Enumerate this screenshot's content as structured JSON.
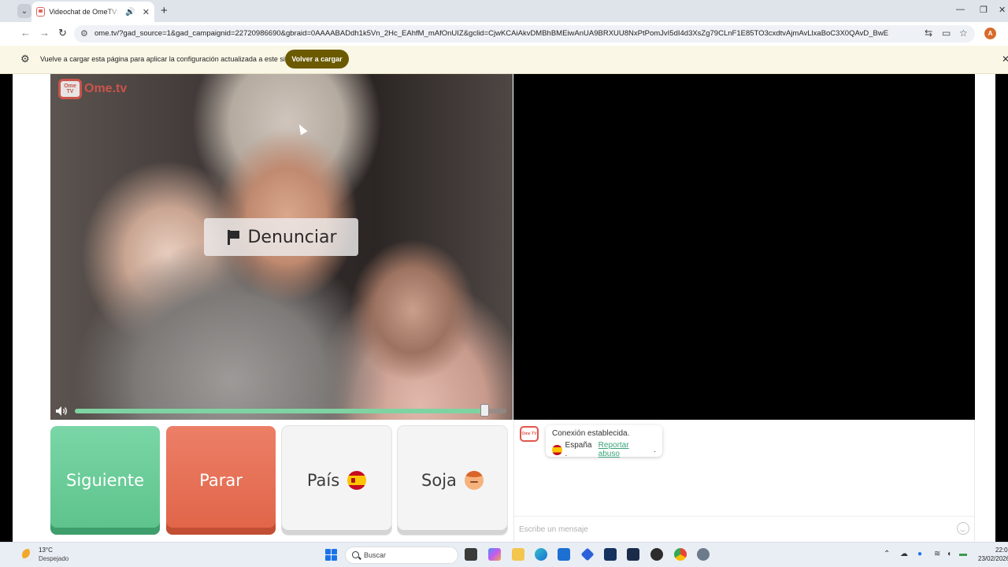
{
  "browser": {
    "tab": {
      "title": "Videochat de OmeTV: una a",
      "audio_icon": "speaker-icon",
      "close_glyph": "✕"
    },
    "tab_list_glyph": "⌄",
    "new_tab_glyph": "+",
    "window_controls": {
      "minimize": "—",
      "maximize": "❐",
      "close": "✕"
    },
    "nav": {
      "back": "←",
      "forward": "→",
      "reload": "↻"
    },
    "url": "ome.tv/?gad_source=1&gad_campaignid=22720986690&gbraid=0AAAABADdh1k5Vn_2Hc_EAhfM_mAfOnUIZ&gclid=CjwKCAiAkvDMBhBMEiwAnUA9BRXUU8NxPtPomJvI5dI4d3XsZg79CLnF1E85TO3cxdtvAjmAvLlxaBoC3X0QAvD_BwE",
    "profile_initial": "A"
  },
  "infobar": {
    "message": "Vuelve a cargar esta página para aplicar la configuración actualizada a este sitio",
    "reload_label": "Volver a cargar",
    "close_glyph": "✕"
  },
  "video": {
    "logo_tv": "Ome TV",
    "logo_text": "Ome.tv",
    "report_label": "Denunciar",
    "volume_level": 0.95
  },
  "controls": {
    "next_label": "Siguiente",
    "stop_label": "Parar",
    "country_label": "País",
    "gender_label": "Soja"
  },
  "chat": {
    "logo_text": "Ome TV",
    "status": "Conexión establecida.",
    "country": "España .",
    "report_link": "Reportar abuso",
    "link_suffix": ".",
    "placeholder": "Escribe un mensaje"
  },
  "taskbar": {
    "temperature": "13°C",
    "condition": "Despejado",
    "search_label": "Buscar",
    "time": "22:0",
    "date": "23/02/2026"
  },
  "colors": {
    "next_button": "#5cc28b",
    "stop_button": "#e06447",
    "brand": "#e0564b",
    "volume_fill": "#7fd3a2"
  }
}
